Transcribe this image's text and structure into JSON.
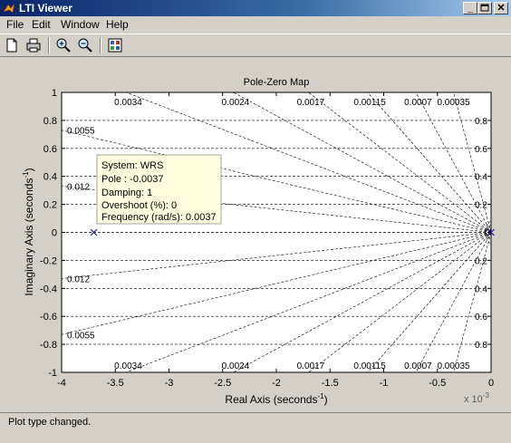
{
  "window": {
    "title": "LTI Viewer"
  },
  "menu": [
    "File",
    "Edit",
    "Window",
    "Help"
  ],
  "toolbar": {
    "icons": [
      "new-file-icon",
      "print-icon",
      "zoom-in-icon",
      "zoom-out-icon",
      "plot-config-icon"
    ]
  },
  "status": {
    "text": "Plot type changed."
  },
  "plot": {
    "title": "Pole-Zero Map",
    "xlabel": "Real Axis (seconds",
    "ylabel": "Imaginary Axis (seconds",
    "unit_superscript": "-1",
    "exponent_base": "x 10",
    "exponent_power": "-3"
  },
  "chart_data": {
    "type": "scatter",
    "title": "Pole-Zero Map",
    "xlabel": "Real Axis (seconds-1)",
    "ylabel": "Imaginary Axis (seconds-1)",
    "xlim": [
      -0.004,
      0
    ],
    "ylim": [
      -1,
      1
    ],
    "x_scale_multiplier": "x 10^-3",
    "x_tick_values": [
      -4,
      -3.5,
      -3,
      -2.5,
      -2,
      -1.5,
      -1,
      -0.5,
      0
    ],
    "x_tick_labels": [
      "-4",
      "-3.5",
      "-3",
      "-2.5",
      "-2",
      "-1.5",
      "-1",
      "-0.5",
      "0"
    ],
    "y_tick_values": [
      -1,
      -0.8,
      -0.6,
      -0.4,
      -0.2,
      0,
      0.2,
      0.4,
      0.6,
      0.8,
      1
    ],
    "y_tick_labels": [
      "-1",
      "-0.8",
      "-0.6",
      "-0.4",
      "-0.2",
      "0",
      "0.2",
      "0.4",
      "0.6",
      "0.8",
      "1"
    ],
    "grid": true,
    "damping_labels": [
      "0.0034",
      "0.0024",
      "0.0017",
      "0.00115",
      "0.0007",
      "0.00035",
      "0.0055",
      "0.012"
    ],
    "damping_labels_bottom": [
      "0.0034",
      "0.0024",
      "0.0017",
      "0.00115",
      "0.0007",
      "0.00035",
      "0.0055",
      "0.012"
    ],
    "frequency_labels_top": [
      "0.8",
      "0.6",
      "0.4",
      "0.2"
    ],
    "frequency_labels_bottom": [
      "0.2",
      "0.4",
      "0.6",
      "0.8"
    ],
    "points": [
      {
        "x": -0.0037,
        "y": 0,
        "marker": "x",
        "name": "WRS"
      },
      {
        "x": 0,
        "y": 0,
        "marker": "x"
      }
    ],
    "datatip": [
      "System: WRS",
      "Pole : -0.0037",
      "Damping: 1",
      "Overshoot (%): 0",
      "Frequency (rad/s): 0.0037"
    ]
  }
}
